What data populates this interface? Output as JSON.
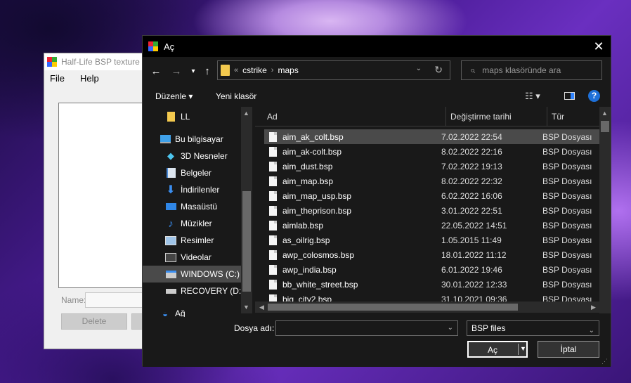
{
  "bg_app": {
    "title": "Half-Life BSP texture t",
    "menu": [
      "File",
      "Help"
    ],
    "name_label": "Name:",
    "delete_label": "Delete"
  },
  "dialog": {
    "title": "Aç",
    "close": "✕",
    "nav": {
      "back": "←",
      "forward": "→",
      "recent": "▾",
      "up": "↑"
    },
    "address": {
      "overflow": "«",
      "crumbs": [
        "cstrike",
        "maps"
      ],
      "chevron": "›",
      "dropdown": "⌄",
      "refresh": "↻"
    },
    "search_placeholder": "maps klasöründe ara",
    "toolbar": {
      "organize": "Düzenle ▾",
      "new_folder": "Yeni klasör",
      "views": "☷ ▾",
      "help": "?"
    },
    "nav_pane": [
      {
        "label": "LL",
        "icon": "folder-icon"
      },
      {
        "label": "Bu bilgisayar",
        "icon": "computer-icon"
      },
      {
        "label": "3D Nesneler",
        "icon": "cube-icon"
      },
      {
        "label": "Belgeler",
        "icon": "documents-icon"
      },
      {
        "label": "İndirilenler",
        "icon": "download-icon"
      },
      {
        "label": "Masaüstü",
        "icon": "desktop-icon"
      },
      {
        "label": "Müzikler",
        "icon": "music-icon"
      },
      {
        "label": "Resimler",
        "icon": "pictures-icon"
      },
      {
        "label": "Videolar",
        "icon": "videos-icon"
      },
      {
        "label": "WINDOWS (C:)",
        "icon": "drive-icon"
      },
      {
        "label": "RECOVERY (D:)",
        "icon": "drive-icon"
      },
      {
        "label": "Ağ",
        "icon": "network-icon"
      }
    ],
    "columns": {
      "name": "Ad",
      "date": "Değiştirme tarihi",
      "type": "Tür"
    },
    "files": [
      {
        "name": "aim_ak_colt.bsp",
        "date": "7.02.2022 22:54",
        "type": "BSP Dosyası"
      },
      {
        "name": "aim_ak-colt.bsp",
        "date": "8.02.2022 22:16",
        "type": "BSP Dosyası"
      },
      {
        "name": "aim_dust.bsp",
        "date": "7.02.2022 19:13",
        "type": "BSP Dosyası"
      },
      {
        "name": "aim_map.bsp",
        "date": "8.02.2022 22:32",
        "type": "BSP Dosyası"
      },
      {
        "name": "aim_map_usp.bsp",
        "date": "6.02.2022 16:06",
        "type": "BSP Dosyası"
      },
      {
        "name": "aim_theprison.bsp",
        "date": "3.01.2022 22:51",
        "type": "BSP Dosyası"
      },
      {
        "name": "aimlab.bsp",
        "date": "22.05.2022 14:51",
        "type": "BSP Dosyası"
      },
      {
        "name": "as_oilrig.bsp",
        "date": "1.05.2015 11:49",
        "type": "BSP Dosyası"
      },
      {
        "name": "awp_colosmos.bsp",
        "date": "18.01.2022 11:12",
        "type": "BSP Dosyası"
      },
      {
        "name": "awp_india.bsp",
        "date": "6.01.2022 19:46",
        "type": "BSP Dosyası"
      },
      {
        "name": "bb_white_street.bsp",
        "date": "30.01.2022 12:33",
        "type": "BSP Dosyası"
      },
      {
        "name": "big_city2.bsp",
        "date": "31.10.2021 09:36",
        "type": "BSP Dosyası"
      }
    ],
    "file_name_label": "Dosya adı:",
    "file_name_value": "",
    "file_type": "BSP files",
    "open_label": "Aç",
    "cancel_label": "İptal",
    "selected_file_index": 0,
    "selected_nav_index": 9
  }
}
